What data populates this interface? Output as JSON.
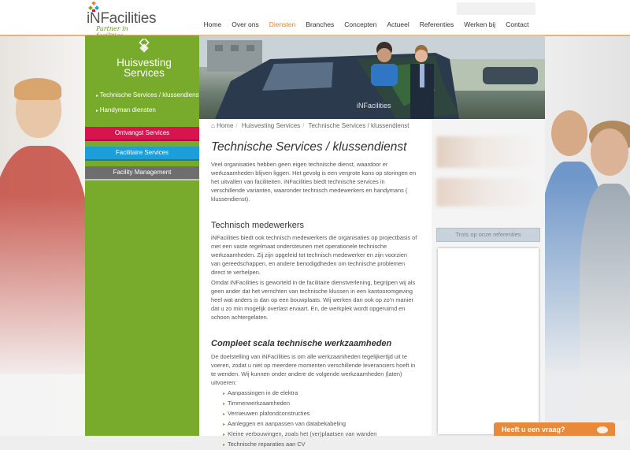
{
  "brand": {
    "logo_prefix": "iN",
    "logo_name": "Facilities",
    "tagline": "Partner in facilities"
  },
  "nav": [
    {
      "label": "Home",
      "active": false
    },
    {
      "label": "Over ons",
      "active": false
    },
    {
      "label": "Diensten",
      "active": true
    },
    {
      "label": "Branches",
      "active": false
    },
    {
      "label": "Concepten",
      "active": false
    },
    {
      "label": "Actueel",
      "active": false
    },
    {
      "label": "Referenties",
      "active": false
    },
    {
      "label": "Werken bij",
      "active": false
    },
    {
      "label": "Contact",
      "active": false
    }
  ],
  "sidebar": {
    "title": "Huisvesting",
    "subtitle": "Services",
    "links": [
      "Technische Services / klussendienst",
      "Handyman diensten"
    ],
    "services": [
      {
        "label": "Ontvangst Services",
        "color": "#d6154f"
      },
      {
        "label": "Facilitaire Services",
        "color": "#1c9ed8"
      },
      {
        "label": "Facility Management",
        "color": "#6e6e6e"
      }
    ]
  },
  "breadcrumb": {
    "home": "Home",
    "section": "Huisvesting Services",
    "current": "Technische Services / klussendienst"
  },
  "article": {
    "title": "Technische Services / klussendienst",
    "intro": "Veel organisaties hebben geen eigen technische dienst, waardoor er werkzaamheden blijven liggen. Het gevolg is een vergrote kans op storingen en het uitvallen van faciliteiten. iNFacilities biedt technische services in verschillende varianten, waaronder technisch medewerkers en handymans ( klussendienst).",
    "section1_title": "Technisch medewerkers",
    "section1_p1": "iNFacilities biedt ook technisch medewerkers die organisaties op projectbasis of met een vaste regelmaat ondersteunen met operationele technische werkzaamheden. Zij zijn opgeleid tot technisch medewerker en zijn voorzien van gereedschappen, en andere benodigdheden om technische problemen direct te verhelpen.",
    "section1_p2": "Omdat iNFacilities is geworteld in de facilitaire dienstverlening, begrijpen wij als geen ander dat het verrichten van technische klussen in een kantooromgeving heel wat anders is dan op een bouwplaats. Wij werken dan ook op zo'n manier dat u zo min mogelijk overlast ervaart. En, de werkplek wordt opgeruimd en schoon achtergelaten.",
    "section2_title": "Compleet scala technische werkzaamheden",
    "section2_p": "De doelstelling van iNFacilities is om alle werkzaamheden tegelijkertijd uit te voeren, zodat u niet op meerdere momenten verschillende leveranciers hoeft in te wenden. Wij kunnen onder andere de volgende werkzaamheden (laten) uitvoeren:",
    "list": [
      "Aanpassingen in de elektra",
      "Timmerwerkzaamheden",
      "Vernieuwen plafondconstructies",
      "Aanleggen en aanpassen van databekabeling",
      "Kleine verbouwingen, zoals het (ver)plaatsen van wanden",
      "Technische reparaties aan CV"
    ]
  },
  "references_button": "Trots op onze referenties",
  "chat_label": "Heeft u een vraag?",
  "hero_van_text": "iNFacilities"
}
